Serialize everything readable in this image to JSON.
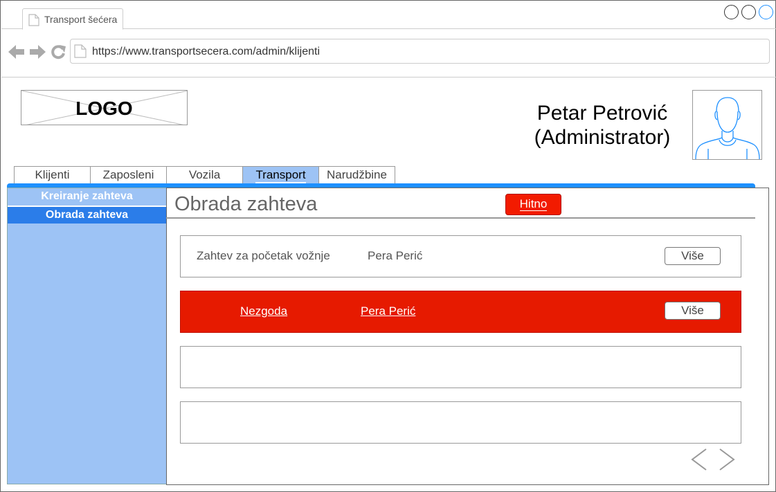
{
  "browser": {
    "tab_title": "Transport šećera",
    "url": "https://www.transportsecera.com/admin/klijenti",
    "window_controls": [
      "circle",
      "circle",
      "circle"
    ],
    "control_colors": {
      "default": "#333333",
      "active": "#1e90ff"
    }
  },
  "header": {
    "logo_text": "LOGO",
    "user_name": "Petar Petrović",
    "user_role": "(Administrator)",
    "avatar_icon": "user-avatar-icon"
  },
  "main_tabs": [
    {
      "label": "Klijenti",
      "active": false
    },
    {
      "label": "Zaposleni",
      "active": false
    },
    {
      "label": "Vozila",
      "active": false
    },
    {
      "label": "Transport",
      "active": true
    },
    {
      "label": "Narudžbine",
      "active": false
    }
  ],
  "sidebar": {
    "items": [
      {
        "label": "Kreiranje zahteva",
        "active": false
      },
      {
        "label": "Obrada zahteva",
        "active": true
      }
    ]
  },
  "main": {
    "title": "Obrada zahteva",
    "urgent_button": "Hitno",
    "requests": [
      {
        "type": "Zahtev za početak vožnje",
        "person": "Pera Perić",
        "button": "Više",
        "urgent": false
      },
      {
        "type": "Nezgoda",
        "person": "Pera Perić",
        "button": "Više",
        "urgent": true
      },
      {
        "type": "",
        "person": "",
        "button": "",
        "urgent": false
      },
      {
        "type": "",
        "person": "",
        "button": "",
        "urgent": false
      }
    ],
    "pager": {
      "prev_icon": "chevron-left-icon",
      "next_icon": "chevron-right-icon"
    }
  },
  "colors": {
    "accent_blue": "#1e90ff",
    "sidebar_blue": "#9dc3f5",
    "active_blue": "#2b7de9",
    "urgent_red": "#e61a00"
  }
}
